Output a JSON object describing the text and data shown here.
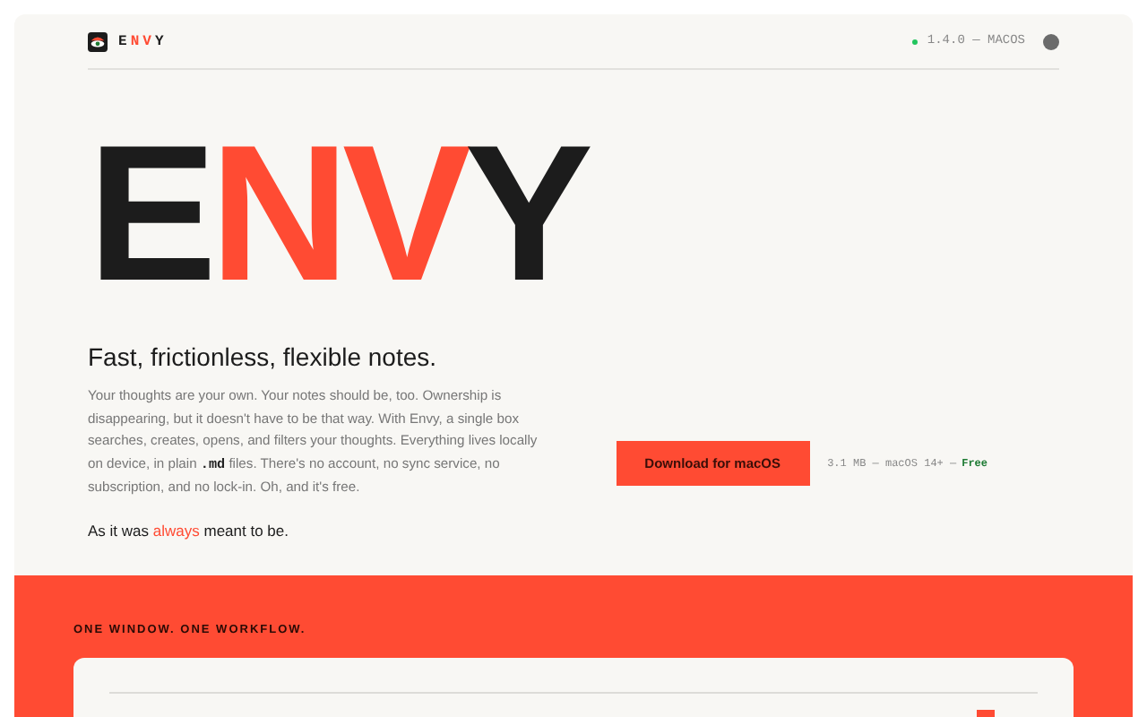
{
  "header": {
    "logo_letters": [
      {
        "text": "E",
        "accent": false
      },
      {
        "text": "N",
        "accent": true
      },
      {
        "text": "V",
        "accent": true
      },
      {
        "text": "Y",
        "accent": false
      }
    ],
    "version": "1.4.0 — MACOS"
  },
  "hero": {
    "letters": [
      {
        "text": "E",
        "accent": false
      },
      {
        "text": "N",
        "accent": true
      },
      {
        "text": "V",
        "accent": true
      },
      {
        "text": "Y",
        "accent": false
      }
    ],
    "tagline": "Fast, frictionless, flexible notes.",
    "body": "Your thoughts are your own. Your notes should be, too. Ownership is disappearing, but it doesn't have to be that way. With Envy, a single box searches, creates, opens, and filters your thoughts. Everything lives locally on device, in plain **.md** files. There's no account, no sync service, no subscription, and no lock-in. Oh, and it's free.",
    "closing_before": "As it was",
    "closing_accent": "always",
    "closing_after": "meant to be.",
    "download_button": "Download for macOS",
    "download_meta": "3.1 MB — macOS 14+ —",
    "download_price": "Free"
  },
  "section": {
    "label": "ONE WINDOW. ONE WORKFLOW."
  }
}
